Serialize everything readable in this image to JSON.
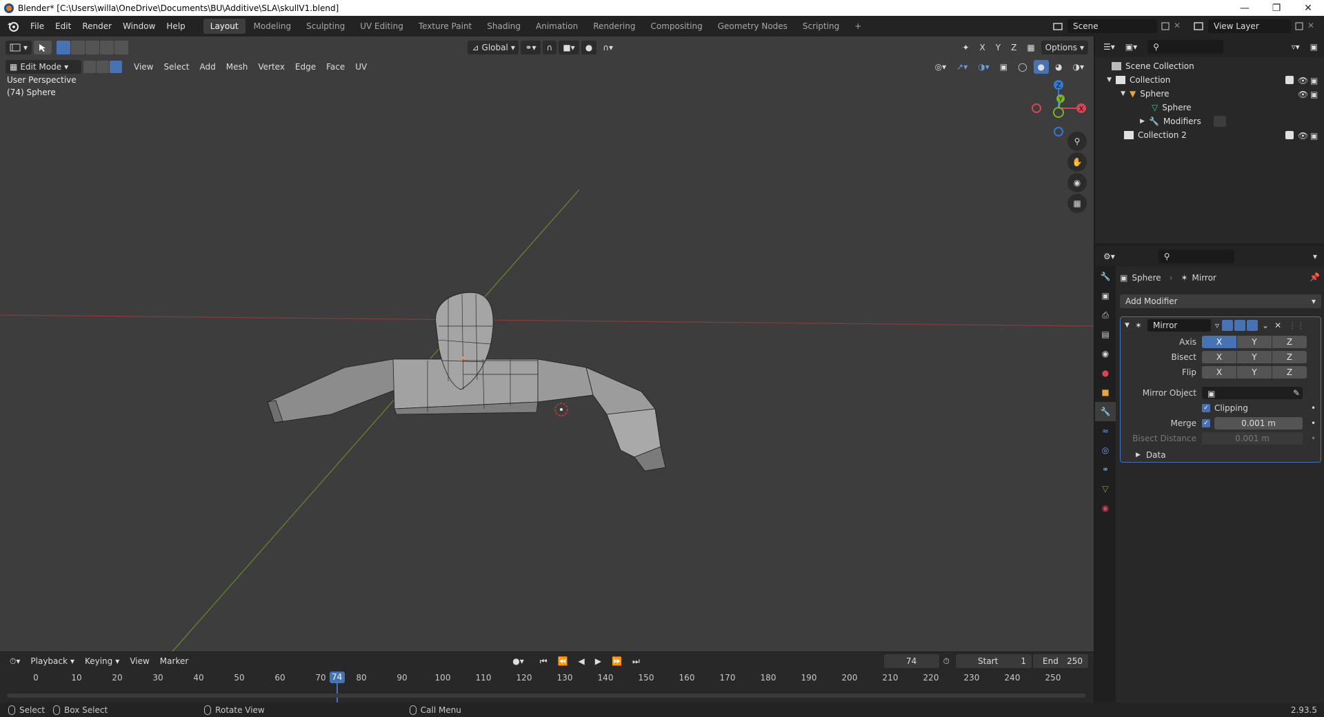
{
  "window": {
    "title": "Blender* [C:\\Users\\willa\\OneDrive\\Documents\\BU\\Additive\\SLA\\skullV1.blend]"
  },
  "menu": [
    "File",
    "Edit",
    "Render",
    "Window",
    "Help"
  ],
  "workspaces": [
    "Layout",
    "Modeling",
    "Sculpting",
    "UV Editing",
    "Texture Paint",
    "Shading",
    "Animation",
    "Rendering",
    "Compositing",
    "Geometry Nodes",
    "Scripting"
  ],
  "active_workspace": "Layout",
  "scene": {
    "name": "Scene",
    "view_layer": "View Layer"
  },
  "viewport": {
    "mode": "Edit Mode",
    "header_menus": [
      "View",
      "Select",
      "Add",
      "Mesh",
      "Vertex",
      "Edge",
      "Face",
      "UV"
    ],
    "transform_orientation": "Global",
    "options_label": "Options",
    "axis_labels": [
      "X",
      "Y",
      "Z"
    ],
    "perspective_label": "User Perspective",
    "object_label": "(74) Sphere",
    "gizmo": {
      "x": "X",
      "y": "Y",
      "z": "Z"
    }
  },
  "outliner": {
    "scene_collection": "Scene Collection",
    "collection": "Collection",
    "sphere_object": "Sphere",
    "sphere_mesh": "Sphere",
    "modifiers": "Modifiers",
    "collection2": "Collection 2"
  },
  "properties": {
    "object_name": "Sphere",
    "modifier_crumb": "Mirror",
    "add_modifier": "Add Modifier",
    "modifier_name": "Mirror",
    "axis_label": "Axis",
    "bisect_label": "Bisect",
    "flip_label": "Flip",
    "axis_buttons": [
      "X",
      "Y",
      "Z"
    ],
    "axis_active": "X",
    "mirror_object_label": "Mirror Object",
    "clipping_label": "Clipping",
    "merge_label": "Merge",
    "merge_value": "0.001 m",
    "bisect_distance_label": "Bisect Distance",
    "bisect_distance_value": "0.001 m",
    "data_label": "Data"
  },
  "timeline": {
    "menus": [
      "Playback",
      "Keying",
      "View",
      "Marker"
    ],
    "current_frame": "74",
    "start_label": "Start",
    "start_value": "1",
    "end_label": "End",
    "end_value": "250",
    "ticks": [
      "0",
      "10",
      "20",
      "30",
      "40",
      "50",
      "60",
      "70",
      "80",
      "90",
      "100",
      "110",
      "120",
      "130",
      "140",
      "150",
      "160",
      "170",
      "180",
      "190",
      "200",
      "210",
      "220",
      "230",
      "240",
      "250"
    ]
  },
  "statusbar": {
    "select": "Select",
    "box_select": "Box Select",
    "rotate_view": "Rotate View",
    "call_menu": "Call Menu",
    "version": "2.93.5"
  },
  "colors": {
    "accent": "#4772b3",
    "x_axis": "#d94452",
    "y_axis": "#7fb130",
    "z_axis": "#2e7bd8"
  }
}
